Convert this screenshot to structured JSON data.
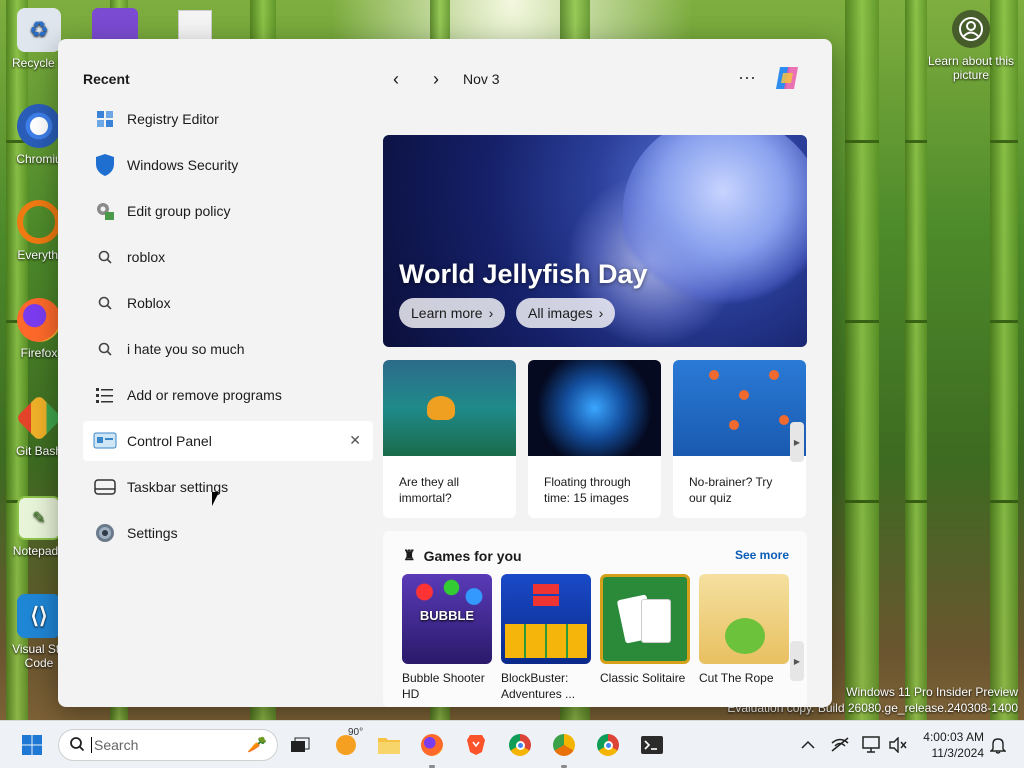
{
  "desktop": {
    "icons": [
      {
        "label": "Recycle B",
        "icon": "recycle-bin-icon"
      },
      {
        "label": "Chromiu",
        "icon": "chromium-icon"
      },
      {
        "label": "Everythi",
        "icon": "everything-search-icon"
      },
      {
        "label": "Firefox",
        "icon": "firefox-icon"
      },
      {
        "label": "Git Bash",
        "icon": "git-bash-icon"
      },
      {
        "label": "Notepad+",
        "icon": "notepad-plus-icon"
      },
      {
        "label": "Visual Stu Code",
        "icon": "vscode-icon"
      }
    ],
    "learn_about_picture": "Learn about this picture",
    "watermark_line1": "Windows 11 Pro Insider Preview",
    "watermark_line2": "Evaluation copy. Build 26080.ge_release.240308-1400"
  },
  "panel": {
    "recent_title": "Recent",
    "recent_items": [
      {
        "label": "Registry Editor",
        "icon": "registry-editor-icon"
      },
      {
        "label": "Windows Security",
        "icon": "shield-icon"
      },
      {
        "label": "Edit group policy",
        "icon": "group-policy-icon"
      },
      {
        "label": "roblox",
        "icon": "search-icon"
      },
      {
        "label": "Roblox",
        "icon": "search-icon"
      },
      {
        "label": "i hate you so much",
        "icon": "search-icon"
      },
      {
        "label": "Add or remove programs",
        "icon": "list-icon"
      },
      {
        "label": "Control Panel",
        "icon": "control-panel-icon"
      },
      {
        "label": "Taskbar settings",
        "icon": "taskbar-icon"
      },
      {
        "label": "Settings",
        "icon": "gear-icon"
      }
    ],
    "close_glyph": "✕",
    "date": "Nov 3",
    "prev_glyph": "‹",
    "next_glyph": "›",
    "more_glyph": "···",
    "hero": {
      "title": "World Jellyfish Day",
      "learn_more": "Learn more",
      "all_images": "All images",
      "chevron": "›"
    },
    "cards": [
      {
        "caption": "Are they all immortal?"
      },
      {
        "caption": "Floating through time: 15 images"
      },
      {
        "caption": "No-brainer? Try our quiz"
      }
    ],
    "games": {
      "title": "Games for you",
      "see_more": "See more",
      "items": [
        {
          "name": "Bubble Shooter HD"
        },
        {
          "name": "BlockBuster: Adventures ..."
        },
        {
          "name": "Classic Solitaire"
        },
        {
          "name": "Cut The Rope"
        }
      ]
    }
  },
  "taskbar": {
    "search_placeholder": "Search",
    "weather_temp": "90°",
    "time": "4:00:03 AM",
    "date": "11/3/2024"
  },
  "colors": {
    "accent": "#0a5cb8",
    "panel_bg": "#f3f3f3"
  }
}
